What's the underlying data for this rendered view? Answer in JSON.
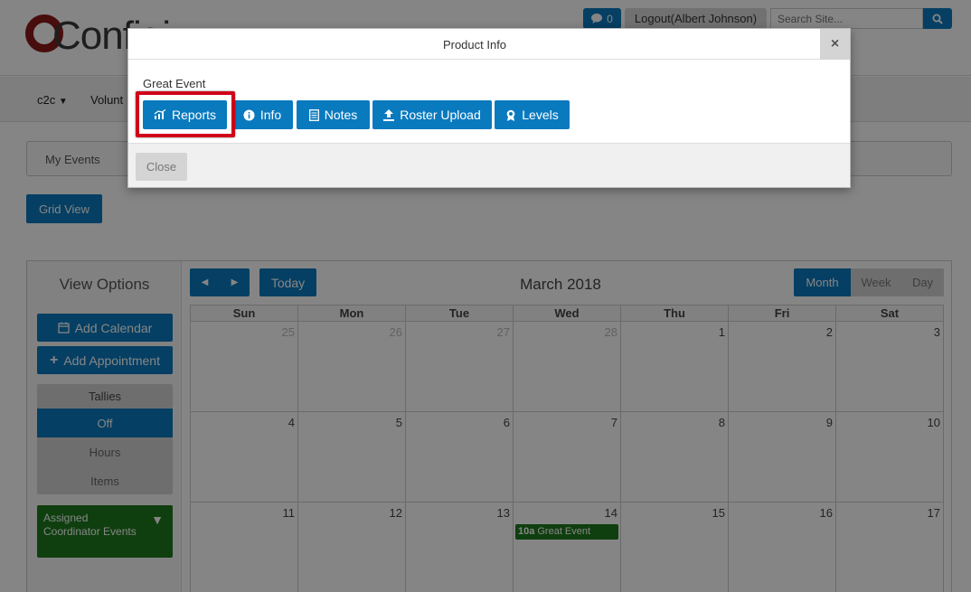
{
  "header": {
    "logo_text": "Configi",
    "message_count": "0",
    "logout_label": "Logout(Albert Johnson)",
    "search_placeholder": "Search Site..."
  },
  "nav": {
    "items": [
      {
        "label": "c2c"
      },
      {
        "label": "Volunt"
      }
    ]
  },
  "tabs": {
    "my_events": "My Events"
  },
  "grid_view_label": "Grid View",
  "sidebar": {
    "title": "View Options",
    "add_calendar": "Add Calendar",
    "add_appointment": "Add Appointment",
    "tallies_title": "Tallies",
    "tally_options": [
      "Off",
      "Hours",
      "Items"
    ],
    "coordinator_label": "Assigned Coordinator Events"
  },
  "calendar": {
    "today_label": "Today",
    "title": "March 2018",
    "views": [
      "Month",
      "Week",
      "Day"
    ],
    "active_view": "Month",
    "days_of_week": [
      "Sun",
      "Mon",
      "Tue",
      "Wed",
      "Thu",
      "Fri",
      "Sat"
    ],
    "weeks": [
      [
        "25",
        "26",
        "27",
        "28",
        "1",
        "2",
        "3"
      ],
      [
        "4",
        "5",
        "6",
        "7",
        "8",
        "9",
        "10"
      ],
      [
        "11",
        "12",
        "13",
        "14",
        "15",
        "16",
        "17"
      ]
    ],
    "event": {
      "time": "10a",
      "title": "Great Event"
    }
  },
  "modal": {
    "title": "Product Info",
    "event_name": "Great Event",
    "actions": {
      "reports": "Reports",
      "info": "Info",
      "notes": "Notes",
      "roster_upload": "Roster Upload",
      "levels": "Levels"
    },
    "close_label": "Close",
    "close_x": "×"
  },
  "colors": {
    "primary": "#0a7abf",
    "event_green": "#1e7a1e",
    "highlight_red": "#d0021b"
  }
}
